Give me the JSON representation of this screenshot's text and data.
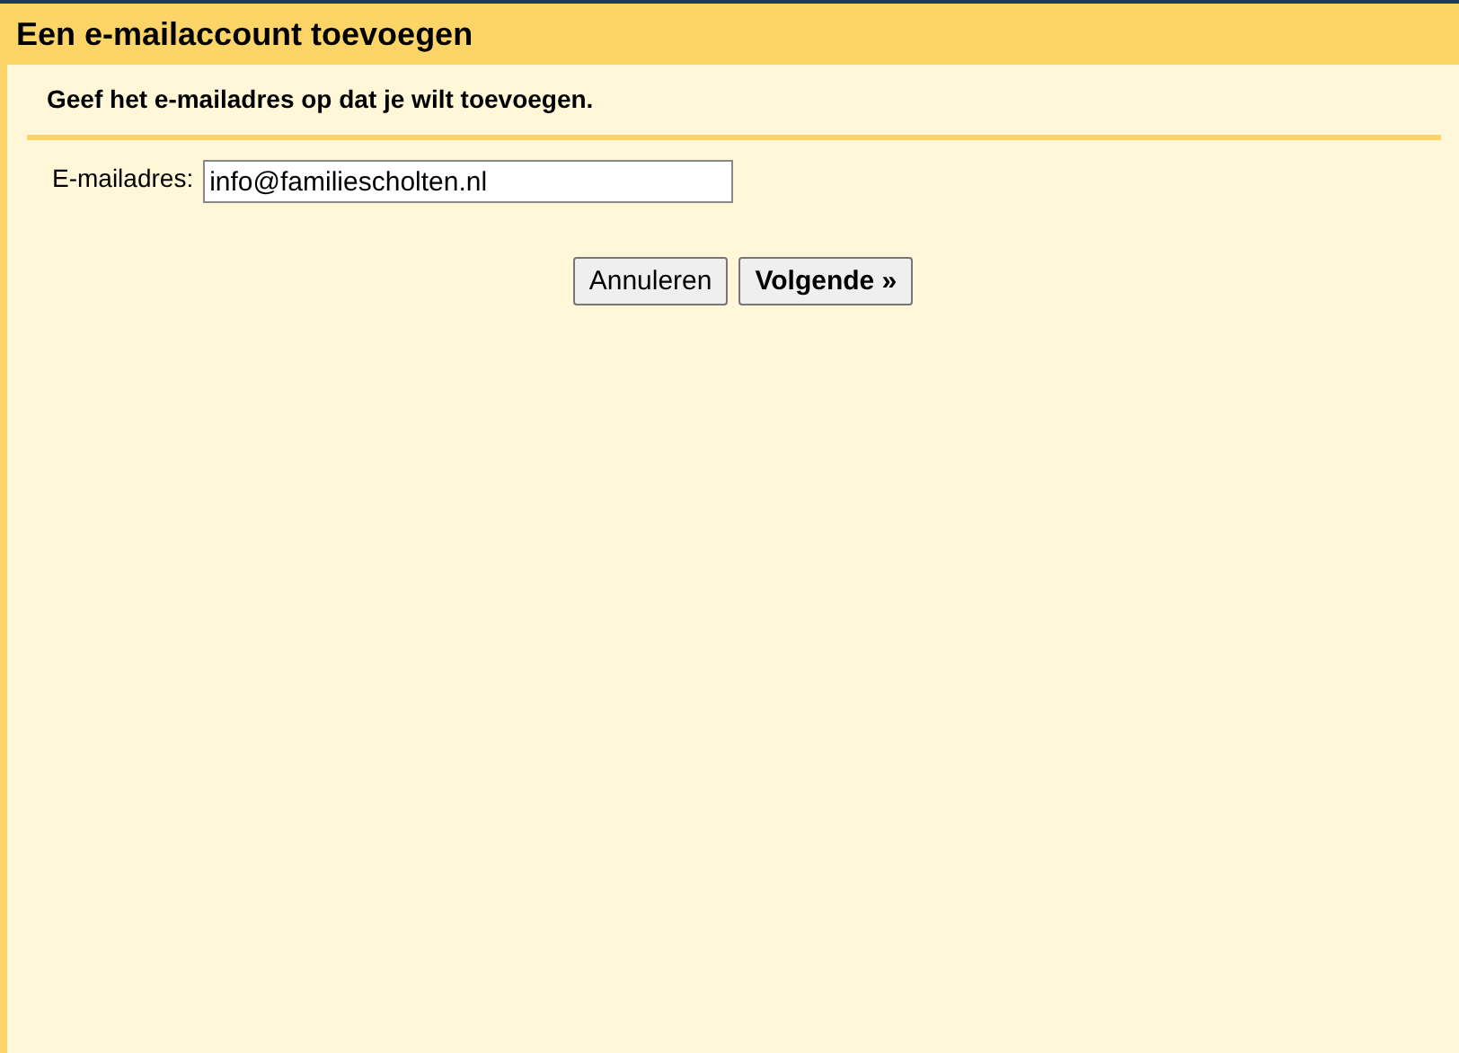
{
  "window": {
    "title": "Een e-mailaccount toevoegen"
  },
  "instruction": "Geef het e-mailadres op dat je wilt toevoegen.",
  "email_field": {
    "label": "E-mailadres:",
    "value": "info@familiescholten.nl"
  },
  "buttons": [
    {
      "label": "Annuleren",
      "kind": "secondary"
    },
    {
      "label": "Volgende »",
      "kind": "primary"
    }
  ]
}
